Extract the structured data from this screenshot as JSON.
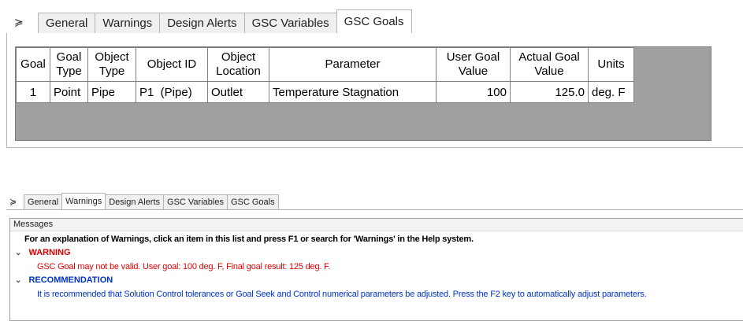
{
  "top": {
    "collapse_glyph": "≽",
    "tabs": [
      {
        "label": "General"
      },
      {
        "label": "Warnings"
      },
      {
        "label": "Design Alerts"
      },
      {
        "label": "GSC Variables"
      },
      {
        "label": "GSC Goals"
      }
    ],
    "active_tab": "GSC Goals",
    "table": {
      "headers": [
        "Goal",
        "Goal Type",
        "Object Type",
        "Object ID",
        "Object Location",
        "Parameter",
        "User Goal Value",
        "Actual Goal Value",
        "Units"
      ],
      "row": {
        "goal": "1",
        "goal_type": "Point",
        "object_type": "Pipe",
        "object_id": "P1  (Pipe)",
        "object_location": "Outlet",
        "parameter": "Temperature Stagnation",
        "user_goal_value": "100",
        "actual_goal_value": "125.0",
        "units": "deg. F"
      }
    }
  },
  "bottom": {
    "collapse_glyph": "≽",
    "tabs": [
      {
        "label": "General"
      },
      {
        "label": "Warnings"
      },
      {
        "label": "Design Alerts"
      },
      {
        "label": "GSC Variables"
      },
      {
        "label": "GSC Goals"
      }
    ],
    "active_tab": "Warnings",
    "messages_header": "Messages",
    "intro": "For an explanation of Warnings, click an item in this list and press F1 or search for 'Warnings' in the Help system.",
    "warning": {
      "title": "WARNING",
      "text": "GSC Goal may not be valid. User goal: 100 deg. F, Final goal result: 125 deg. F.",
      "color": "#e00000"
    },
    "recommendation": {
      "title": "RECOMMENDATION",
      "text": "It is recommended that Solution Control tolerances or Goal Seek and Control numerical parameters be adjusted. Press the F2 key to automatically adjust parameters.",
      "color": "#0033cc"
    }
  }
}
